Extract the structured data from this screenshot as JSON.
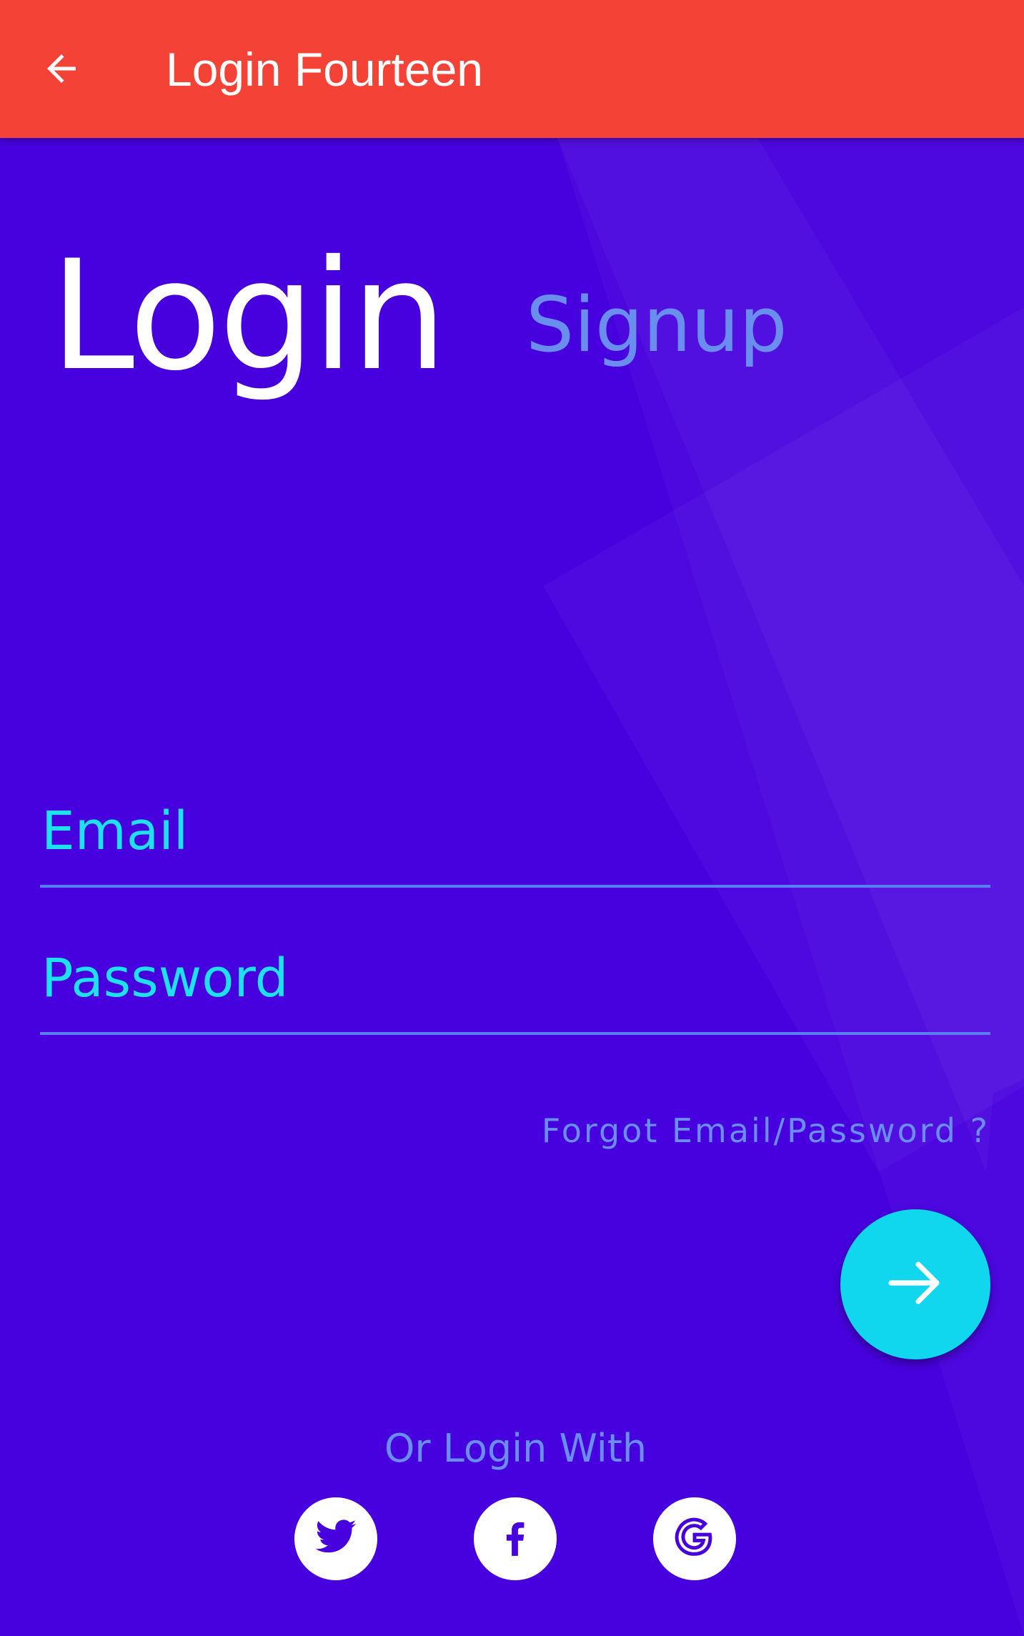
{
  "appbar": {
    "title": "Login Fourteen",
    "back_icon": "arrow-back-icon",
    "color": "#f44336"
  },
  "tabs": {
    "login_label": "Login",
    "signup_label": "Signup"
  },
  "form": {
    "email_placeholder": "Email",
    "password_placeholder": "Password",
    "forgot_label": "Forgot Email/Password ?"
  },
  "submit": {
    "icon": "arrow-forward-icon",
    "color": "#10d6ee"
  },
  "social": {
    "heading": "Or Login With",
    "providers": [
      {
        "name": "twitter",
        "icon": "twitter-icon"
      },
      {
        "name": "facebook",
        "icon": "facebook-icon"
      },
      {
        "name": "google",
        "icon": "google-icon"
      }
    ]
  },
  "colors": {
    "background": "#4700de",
    "accent_cyan": "#1ee0ee",
    "muted_blue": "#6a8ef0"
  }
}
